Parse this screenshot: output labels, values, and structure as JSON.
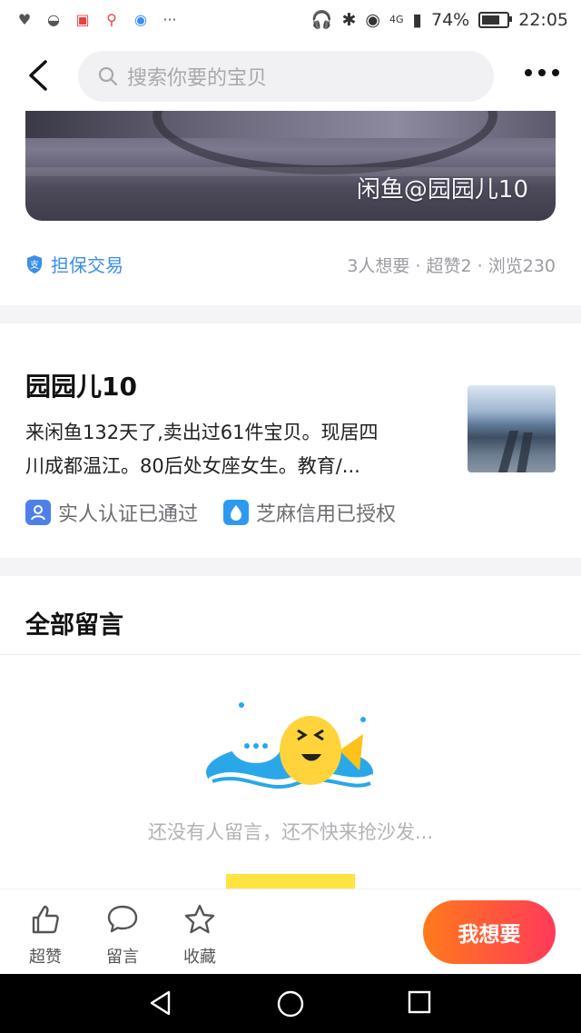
{
  "status_bar": {
    "battery": "74%",
    "time": "22:05",
    "network": "4G",
    "battery_fill": 0.74
  },
  "search": {
    "placeholder": "搜索你要的宝贝"
  },
  "photo": {
    "watermark": "闲鱼@园园儿10"
  },
  "info": {
    "guarantee": "担保交易",
    "stats": "3人想要 · 超赞2 · 浏览230"
  },
  "seller": {
    "name": "园园儿10",
    "bio_line1": "来闲鱼132天了,卖出过61件宝贝。现居四",
    "bio_line2": "川成都温江。80后处女座女生。教育/...",
    "badge_real": "实人认证已通过",
    "badge_zhima": "芝麻信用已授权"
  },
  "comments": {
    "title": "全部留言",
    "empty_text": "还没有人留言，还不快来抢沙发..."
  },
  "bottom": {
    "like": "超赞",
    "comment": "留言",
    "favorite": "收藏",
    "want": "我想要"
  },
  "colors": {
    "accent_blue": "#3a8fe8",
    "want_start": "#ff7a1a",
    "want_end": "#ff3a5a",
    "yellow": "#ffe33f"
  }
}
